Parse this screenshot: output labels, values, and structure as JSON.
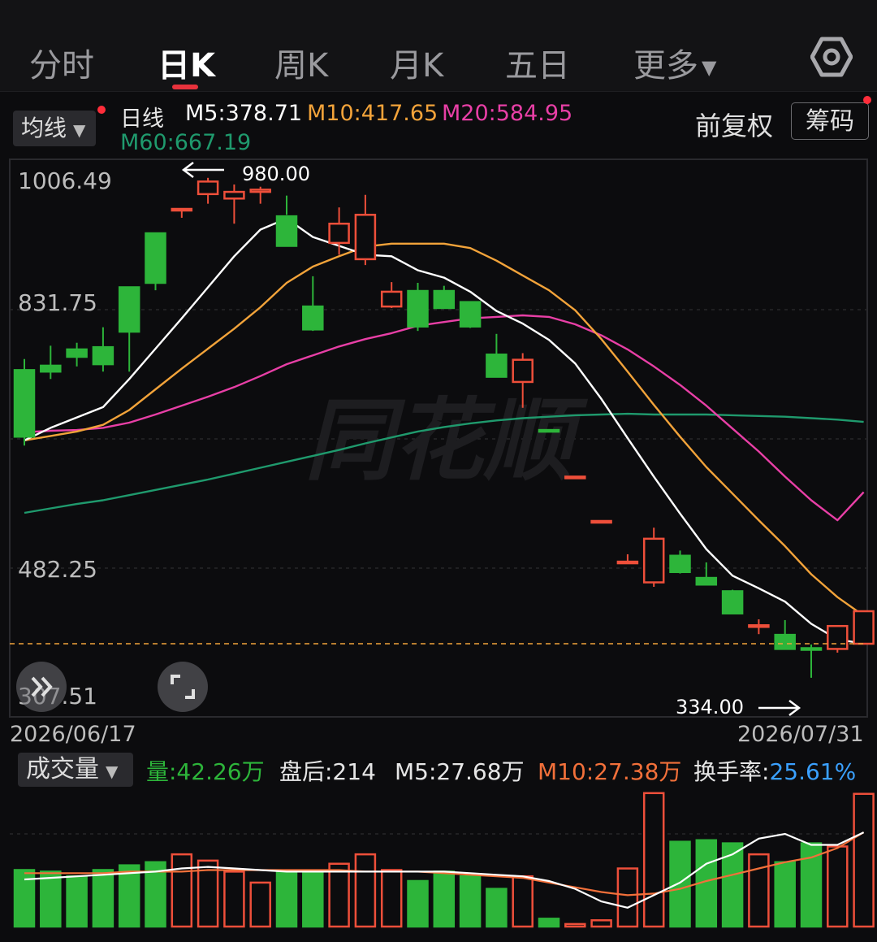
{
  "tabs": [
    {
      "label": "分时",
      "active": false
    },
    {
      "label": "日K",
      "active": true
    },
    {
      "label": "周K",
      "active": false
    },
    {
      "label": "月K",
      "active": false
    },
    {
      "label": "五日",
      "active": false
    },
    {
      "label": "更多",
      "active": false,
      "dropdown": true
    }
  ],
  "ma_dropdown": "均线",
  "ma_legend": {
    "line_type": "日线",
    "m5": "M5:378.71",
    "m10": "M10:417.65",
    "m20": "M20:584.95",
    "m60": "M60:667.19"
  },
  "adjust_label": "前复权",
  "chip_button": "筹码",
  "price_axis": [
    "1006.49",
    "831.75",
    "482.25",
    "307.51"
  ],
  "dates": {
    "start": "2026/06/17",
    "end": "2026/07/31"
  },
  "annotations": {
    "high": "980.00",
    "low": "334.00"
  },
  "watermark": "同花顺",
  "volume_panel": {
    "dropdown": "成交量",
    "vol": "量:42.26万",
    "after_hours": "盘后:214",
    "m5": "M5:27.68万",
    "m10": "M10:27.38万",
    "turnover_label": "换手率:",
    "turnover_value": "25.61%"
  },
  "colors": {
    "up": "#ee4f3a",
    "down": "#2db53a",
    "ma5": "#ffffff",
    "ma10": "#f2a33a",
    "ma20": "#e83fa6",
    "ma60": "#1f9a6d",
    "accent": "#e8323c",
    "turnover": "#3aa0ff"
  },
  "chart_data": {
    "type": "candlestick",
    "y_range": [
      307.51,
      1006.49
    ],
    "last_price": 380,
    "candles": [
      {
        "o": 750,
        "c": 660,
        "h": 765,
        "l": 648
      },
      {
        "o": 756,
        "c": 748,
        "h": 783,
        "l": 738
      },
      {
        "o": 778,
        "c": 768,
        "h": 787,
        "l": 755
      },
      {
        "o": 781,
        "c": 758,
        "h": 808,
        "l": 748
      },
      {
        "o": 862,
        "c": 802,
        "h": 862,
        "l": 748
      },
      {
        "o": 935,
        "c": 868,
        "h": 935,
        "l": 858
      },
      {
        "o": 967,
        "c": 968,
        "h": 968,
        "l": 956
      },
      {
        "o": 988,
        "c": 1005,
        "h": 1010,
        "l": 975
      },
      {
        "o": 982,
        "c": 991,
        "h": 1001,
        "l": 948
      },
      {
        "o": 991,
        "c": 994,
        "h": 998,
        "l": 975
      },
      {
        "o": 958,
        "c": 918,
        "h": 986,
        "l": 960
      },
      {
        "o": 836,
        "c": 805,
        "h": 877,
        "l": 803
      },
      {
        "o": 922,
        "c": 948,
        "h": 970,
        "l": 906
      },
      {
        "o": 900,
        "c": 960,
        "h": 987,
        "l": 892
      },
      {
        "o": 836,
        "c": 856,
        "h": 869,
        "l": 834
      },
      {
        "o": 857,
        "c": 809,
        "h": 868,
        "l": 803
      },
      {
        "o": 857,
        "c": 834,
        "h": 864,
        "l": 840
      },
      {
        "o": 842,
        "c": 809,
        "h": 843,
        "l": 807
      },
      {
        "o": 771,
        "c": 741,
        "h": 799,
        "l": 741
      },
      {
        "o": 734,
        "c": 764,
        "h": 773,
        "l": 699
      },
      {
        "o": 669,
        "c": 668,
        "h": 669,
        "l": 668
      },
      {
        "o": 606,
        "c": 606,
        "h": 606,
        "l": 606
      },
      {
        "o": 546,
        "c": 546,
        "h": 546,
        "l": 546
      },
      {
        "o": 491,
        "c": 491,
        "h": 501,
        "l": 490
      },
      {
        "o": 463,
        "c": 522,
        "h": 537,
        "l": 457
      },
      {
        "o": 499,
        "c": 477,
        "h": 506,
        "l": 475
      },
      {
        "o": 469,
        "c": 460,
        "h": 490,
        "l": 459
      },
      {
        "o": 451,
        "c": 421,
        "h": 453,
        "l": 421
      },
      {
        "o": 405,
        "c": 405,
        "h": 413,
        "l": 393
      },
      {
        "o": 392,
        "c": 373,
        "h": 412,
        "l": 373
      },
      {
        "o": 374,
        "c": 373,
        "h": 379,
        "l": 334
      },
      {
        "o": 373,
        "c": 404,
        "h": 404,
        "l": 368
      },
      {
        "o": 380,
        "c": 424,
        "h": 424,
        "l": 380
      }
    ],
    "ma5": [
      655,
      672,
      686,
      700,
      738,
      779,
      820,
      862,
      904,
      940,
      955,
      930,
      918,
      906,
      904,
      885,
      875,
      856,
      830,
      813,
      791,
      759,
      711,
      658,
      606,
      556,
      508,
      472,
      455,
      437,
      407,
      386,
      380
    ],
    "ma10": [
      655,
      661,
      667,
      676,
      696,
      724,
      752,
      779,
      806,
      835,
      868,
      890,
      904,
      917,
      921,
      921,
      921,
      915,
      898,
      878,
      858,
      831,
      792,
      748,
      703,
      660,
      619,
      583,
      547,
      512,
      474,
      443,
      418
    ],
    "ma20": [
      666,
      668,
      669,
      672,
      679,
      690,
      702,
      714,
      727,
      742,
      758,
      770,
      782,
      792,
      800,
      810,
      815,
      820,
      822,
      824,
      822,
      812,
      797,
      778,
      755,
      730,
      702,
      671,
      640,
      606,
      574,
      547,
      585
    ],
    "ma60": [
      557,
      563,
      569,
      574,
      581,
      588,
      595,
      602,
      610,
      618,
      626,
      634,
      642,
      651,
      659,
      667,
      673,
      678,
      682,
      685,
      687,
      689,
      690,
      691,
      690,
      690,
      690,
      689,
      688,
      687,
      685,
      683,
      680
    ],
    "volume": {
      "y_range": [
        0,
        44
      ],
      "values": [
        18,
        17.5,
        16,
        18,
        19.5,
        20.5,
        23,
        21,
        17.5,
        14,
        17.5,
        17.5,
        20,
        23,
        18,
        14.5,
        17.5,
        16,
        12,
        16,
        2.5,
        0.8,
        2,
        18.5,
        42.5,
        27,
        27.5,
        26.5,
        23,
        20.5,
        26.5,
        25.5,
        42.26
      ],
      "ma5": [
        15,
        15.5,
        16,
        16.5,
        17,
        17.5,
        18.5,
        19,
        18.5,
        18,
        17.5,
        17.5,
        17.5,
        17.5,
        17.5,
        17.5,
        17.5,
        17,
        16.5,
        16,
        14.5,
        12,
        8,
        6,
        10,
        14,
        20,
        23,
        28,
        29.5,
        26,
        26,
        30
      ],
      "ma10": [
        17,
        17,
        17,
        17,
        17.5,
        17.5,
        17.5,
        18,
        18,
        18,
        18,
        18,
        18,
        17.5,
        17.5,
        17.5,
        17,
        16.5,
        16,
        15.5,
        14,
        12.5,
        11,
        10,
        10.5,
        12,
        14.5,
        16.5,
        18.5,
        20.5,
        22,
        25,
        30
      ]
    }
  }
}
